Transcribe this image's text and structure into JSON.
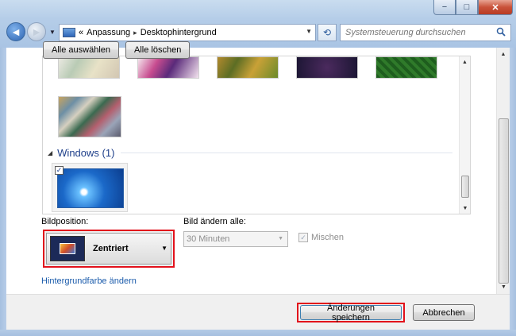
{
  "window": {
    "controls": {
      "minimize": "−",
      "maximize": "□",
      "close": "✕"
    }
  },
  "nav": {
    "back_icon": "arrow-left-icon",
    "forward_icon": "arrow-right-icon"
  },
  "address": {
    "prefix": "«",
    "segments": [
      "Anpassung",
      "Desktophintergrund"
    ],
    "separator": "▸",
    "refresh_icon": "refresh-icon"
  },
  "search": {
    "placeholder": "Systemsteuerung durchsuchen"
  },
  "gallery": {
    "select_all_label": "Alle auswählen",
    "clear_all_label": "Alle löschen",
    "group_title": "Windows (1)",
    "item_checked": true,
    "check_mark": "✓"
  },
  "picture_position": {
    "label": "Bildposition:",
    "value": "Zentriert"
  },
  "change_interval": {
    "label": "Bild ändern alle:",
    "value": "30 Minuten",
    "shuffle_label": "Mischen",
    "shuffle_checked": true,
    "check_mark": "✓"
  },
  "links": {
    "background_color": "Hintergrundfarbe ändern"
  },
  "footer": {
    "save_label": "Änderungen speichern",
    "cancel_label": "Abbrechen"
  },
  "colors": {
    "highlight_border": "#e2111b",
    "link": "#1a5bab",
    "group_title": "#1e3f8a"
  }
}
